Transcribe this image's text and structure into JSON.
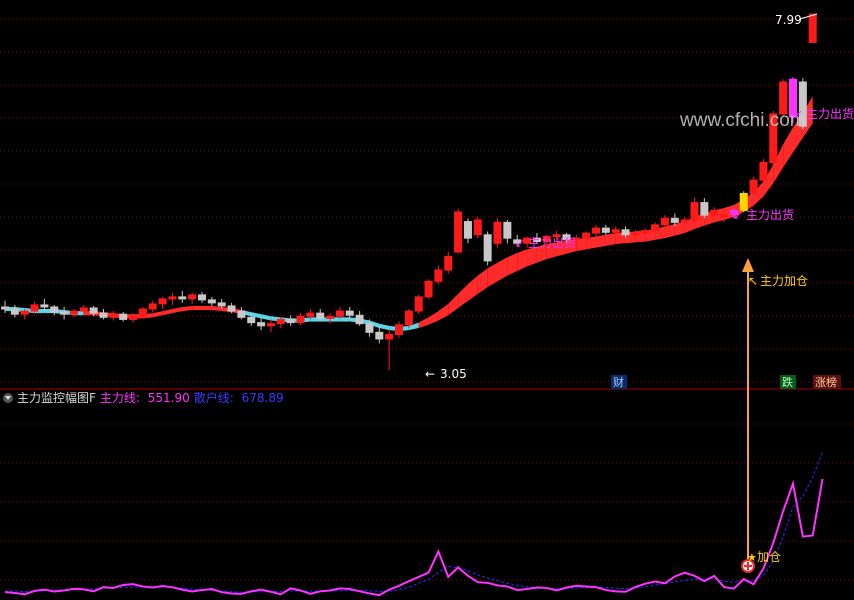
{
  "colors": {
    "background": "#000000",
    "grid": "#8a0000",
    "candle_up": "#ff1a1a",
    "candle_down": "#c8c8c8",
    "ribbon_red": "#ff2a2a",
    "ribbon_cyan": "#5ad6e6",
    "magenta": "#ff33ff",
    "blue_dashed": "#2a2aff",
    "signal_yellow": "#ffd700",
    "arrow_orange": "#ffa040",
    "label_yellow": "#ffd000"
  },
  "header": {
    "title": "主力监控幅图F",
    "main_line_label": "主力线:",
    "main_line_value": "551.90",
    "retail_line_label": "散户线:",
    "retail_line_value": "678.89"
  },
  "watermark": "www.cfchi.com",
  "annotations": {
    "high_price": "7.99",
    "low_price": "3.05",
    "distribution_1": "主力出货",
    "distribution_2": "主力出货",
    "distribution_3": "主力出货",
    "add_position": "主力加仓",
    "add_position_sub": "加仓"
  },
  "badges": {
    "finance": "财",
    "drop": "跌",
    "top_list": "涨榜"
  },
  "chart_data": [
    {
      "type": "candlestick",
      "title": "",
      "xlabel": "",
      "ylabel": "",
      "grid": true,
      "scale": "log",
      "ylim": [
        2.9,
        8.3
      ],
      "series": [
        {
          "name": "",
          "style": "ohlc",
          "ohlc": [
            [
              3.62,
              3.68,
              3.56,
              3.6
            ],
            [
              3.6,
              3.64,
              3.52,
              3.55
            ],
            [
              3.55,
              3.6,
              3.5,
              3.58
            ],
            [
              3.58,
              3.67,
              3.55,
              3.64
            ],
            [
              3.64,
              3.7,
              3.58,
              3.62
            ],
            [
              3.62,
              3.64,
              3.54,
              3.57
            ],
            [
              3.57,
              3.62,
              3.5,
              3.55
            ],
            [
              3.55,
              3.6,
              3.52,
              3.58
            ],
            [
              3.58,
              3.64,
              3.55,
              3.61
            ],
            [
              3.61,
              3.63,
              3.53,
              3.56
            ],
            [
              3.56,
              3.6,
              3.5,
              3.52
            ],
            [
              3.52,
              3.58,
              3.49,
              3.55
            ],
            [
              3.55,
              3.57,
              3.48,
              3.5
            ],
            [
              3.5,
              3.56,
              3.47,
              3.53
            ],
            [
              3.53,
              3.62,
              3.51,
              3.6
            ],
            [
              3.6,
              3.68,
              3.57,
              3.65
            ],
            [
              3.65,
              3.72,
              3.6,
              3.7
            ],
            [
              3.7,
              3.76,
              3.64,
              3.72
            ],
            [
              3.72,
              3.78,
              3.66,
              3.7
            ],
            [
              3.7,
              3.76,
              3.65,
              3.74
            ],
            [
              3.74,
              3.77,
              3.66,
              3.69
            ],
            [
              3.69,
              3.72,
              3.63,
              3.66
            ],
            [
              3.66,
              3.7,
              3.6,
              3.63
            ],
            [
              3.63,
              3.66,
              3.56,
              3.58
            ],
            [
              3.58,
              3.62,
              3.5,
              3.52
            ],
            [
              3.52,
              3.56,
              3.44,
              3.47
            ],
            [
              3.47,
              3.52,
              3.4,
              3.44
            ],
            [
              3.44,
              3.5,
              3.38,
              3.46
            ],
            [
              3.46,
              3.52,
              3.42,
              3.5
            ],
            [
              3.5,
              3.54,
              3.44,
              3.47
            ],
            [
              3.47,
              3.56,
              3.45,
              3.53
            ],
            [
              3.53,
              3.6,
              3.5,
              3.56
            ],
            [
              3.56,
              3.6,
              3.48,
              3.51
            ],
            [
              3.51,
              3.56,
              3.46,
              3.53
            ],
            [
              3.53,
              3.62,
              3.51,
              3.58
            ],
            [
              3.58,
              3.62,
              3.5,
              3.54
            ],
            [
              3.54,
              3.58,
              3.44,
              3.46
            ],
            [
              3.46,
              3.5,
              3.34,
              3.38
            ],
            [
              3.38,
              3.44,
              3.28,
              3.32
            ],
            [
              3.32,
              3.4,
              3.05,
              3.36
            ],
            [
              3.36,
              3.48,
              3.33,
              3.45
            ],
            [
              3.45,
              3.6,
              3.42,
              3.58
            ],
            [
              3.58,
              3.74,
              3.55,
              3.72
            ],
            [
              3.72,
              3.9,
              3.7,
              3.88
            ],
            [
              3.88,
              4.05,
              3.85,
              4.0
            ],
            [
              4.0,
              4.2,
              3.96,
              4.15
            ],
            [
              4.2,
              4.72,
              4.18,
              4.68
            ],
            [
              4.56,
              4.6,
              4.3,
              4.36
            ],
            [
              4.4,
              4.62,
              4.36,
              4.58
            ],
            [
              4.4,
              4.44,
              4.05,
              4.1
            ],
            [
              4.3,
              4.6,
              4.25,
              4.55
            ],
            [
              4.55,
              4.58,
              4.3,
              4.36
            ],
            [
              4.34,
              4.4,
              4.26,
              4.3
            ],
            [
              4.3,
              4.38,
              4.25,
              4.36
            ],
            [
              4.36,
              4.42,
              4.29,
              4.32
            ],
            [
              4.32,
              4.4,
              4.28,
              4.38
            ],
            [
              4.38,
              4.45,
              4.33,
              4.4
            ],
            [
              4.4,
              4.42,
              4.3,
              4.34
            ],
            [
              4.34,
              4.4,
              4.28,
              4.36
            ],
            [
              4.36,
              4.44,
              4.32,
              4.42
            ],
            [
              4.42,
              4.52,
              4.38,
              4.48
            ],
            [
              4.48,
              4.52,
              4.4,
              4.43
            ],
            [
              4.43,
              4.5,
              4.38,
              4.46
            ],
            [
              4.46,
              4.5,
              4.36,
              4.4
            ],
            [
              4.4,
              4.46,
              4.35,
              4.42
            ],
            [
              4.42,
              4.48,
              4.38,
              4.45
            ],
            [
              4.45,
              4.55,
              4.42,
              4.52
            ],
            [
              4.52,
              4.64,
              4.48,
              4.6
            ],
            [
              4.6,
              4.66,
              4.5,
              4.55
            ],
            [
              4.55,
              4.62,
              4.5,
              4.58
            ],
            [
              4.58,
              4.86,
              4.55,
              4.8
            ],
            [
              4.8,
              4.86,
              4.6,
              4.64
            ],
            [
              4.64,
              4.74,
              4.6,
              4.7
            ],
            [
              4.62,
              4.72,
              4.55,
              4.65
            ],
            [
              4.65,
              4.75,
              4.6,
              4.7
            ],
            [
              4.7,
              4.95,
              4.68,
              4.92
            ],
            [
              4.92,
              5.15,
              4.88,
              5.1
            ],
            [
              5.1,
              5.4,
              5.06,
              5.35
            ],
            [
              5.35,
              6.15,
              5.3,
              6.1
            ],
            [
              6.1,
              6.7,
              6.05,
              6.65
            ],
            [
              6.7,
              6.74,
              5.95,
              6.05
            ],
            [
              6.65,
              6.72,
              5.85,
              5.9
            ],
            [
              7.4,
              8.0,
              7.4,
              7.99
            ]
          ]
        },
        {
          "name": "",
          "style": "ribbon",
          "upper": [
            3.62,
            3.62,
            3.61,
            3.6,
            3.6,
            3.6,
            3.59,
            3.58,
            3.58,
            3.58,
            3.57,
            3.56,
            3.55,
            3.55,
            3.55,
            3.56,
            3.58,
            3.6,
            3.62,
            3.63,
            3.63,
            3.63,
            3.62,
            3.61,
            3.59,
            3.57,
            3.55,
            3.53,
            3.52,
            3.51,
            3.51,
            3.52,
            3.52,
            3.52,
            3.52,
            3.52,
            3.51,
            3.49,
            3.46,
            3.44,
            3.43,
            3.44,
            3.47,
            3.52,
            3.58,
            3.65,
            3.75,
            3.85,
            3.94,
            4.02,
            4.08,
            4.14,
            4.19,
            4.23,
            4.26,
            4.29,
            4.31,
            4.33,
            4.35,
            4.36,
            4.38,
            4.4,
            4.42,
            4.43,
            4.44,
            4.45,
            4.47,
            4.5,
            4.53,
            4.56,
            4.62,
            4.66,
            4.7,
            4.73,
            4.77,
            4.84,
            4.94,
            5.08,
            5.32,
            5.62,
            5.88,
            6.12,
            6.4
          ],
          "lower": [
            3.58,
            3.58,
            3.57,
            3.56,
            3.56,
            3.56,
            3.55,
            3.54,
            3.54,
            3.54,
            3.53,
            3.52,
            3.51,
            3.51,
            3.51,
            3.52,
            3.54,
            3.56,
            3.58,
            3.59,
            3.59,
            3.59,
            3.58,
            3.57,
            3.55,
            3.53,
            3.51,
            3.49,
            3.48,
            3.47,
            3.47,
            3.48,
            3.48,
            3.48,
            3.48,
            3.48,
            3.47,
            3.45,
            3.42,
            3.4,
            3.39,
            3.4,
            3.42,
            3.45,
            3.49,
            3.54,
            3.61,
            3.68,
            3.75,
            3.82,
            3.88,
            3.94,
            3.99,
            4.04,
            4.08,
            4.12,
            4.15,
            4.18,
            4.21,
            4.23,
            4.25,
            4.27,
            4.29,
            4.3,
            4.31,
            4.32,
            4.34,
            4.36,
            4.39,
            4.42,
            4.47,
            4.51,
            4.55,
            4.58,
            4.62,
            4.68,
            4.76,
            4.88,
            5.06,
            5.28,
            5.5,
            5.72,
            5.95
          ]
        }
      ]
    },
    {
      "type": "line",
      "title": "",
      "xlabel": "",
      "ylabel": "",
      "grid": true,
      "ylim": [
        0,
        900
      ],
      "series": [
        {
          "name": "主力线",
          "values": [
            18,
            14,
            8,
            24,
            30,
            21,
            26,
            34,
            31,
            22,
            42,
            38,
            52,
            56,
            45,
            40,
            47,
            41,
            30,
            21,
            28,
            33,
            18,
            12,
            10,
            22,
            30,
            20,
            8,
            36,
            26,
            10,
            22,
            26,
            36,
            33,
            22,
            12,
            4,
            30,
            48,
            70,
            90,
            110,
            210,
            90,
            135,
            95,
            65,
            62,
            50,
            45,
            28,
            33,
            40,
            38,
            26,
            40,
            48,
            45,
            42,
            28,
            22,
            20,
            42,
            58,
            68,
            60,
            92,
            110,
            95,
            70,
            95,
            42,
            35,
            80,
            55,
            130,
            250,
            400,
            530,
            280,
            285,
            551.9
          ]
        },
        {
          "name": "散户线",
          "values": [
            22,
            24,
            20,
            22,
            25,
            28,
            29,
            31,
            31,
            33,
            36,
            39,
            41,
            42,
            43,
            42,
            42,
            40,
            36,
            33,
            29,
            26,
            23,
            20,
            18,
            18,
            20,
            21,
            22,
            24,
            24,
            23,
            23,
            24,
            25,
            26,
            26,
            25,
            22,
            22,
            29,
            42,
            60,
            78,
            112,
            140,
            132,
            120,
            100,
            85,
            72,
            60,
            50,
            44,
            40,
            38,
            35,
            36,
            38,
            40,
            41,
            40,
            37,
            35,
            38,
            44,
            52,
            58,
            66,
            74,
            78,
            80,
            82,
            70,
            65,
            70,
            72,
            95,
            165,
            280,
            420,
            470,
            560,
            678.89
          ]
        }
      ]
    }
  ]
}
